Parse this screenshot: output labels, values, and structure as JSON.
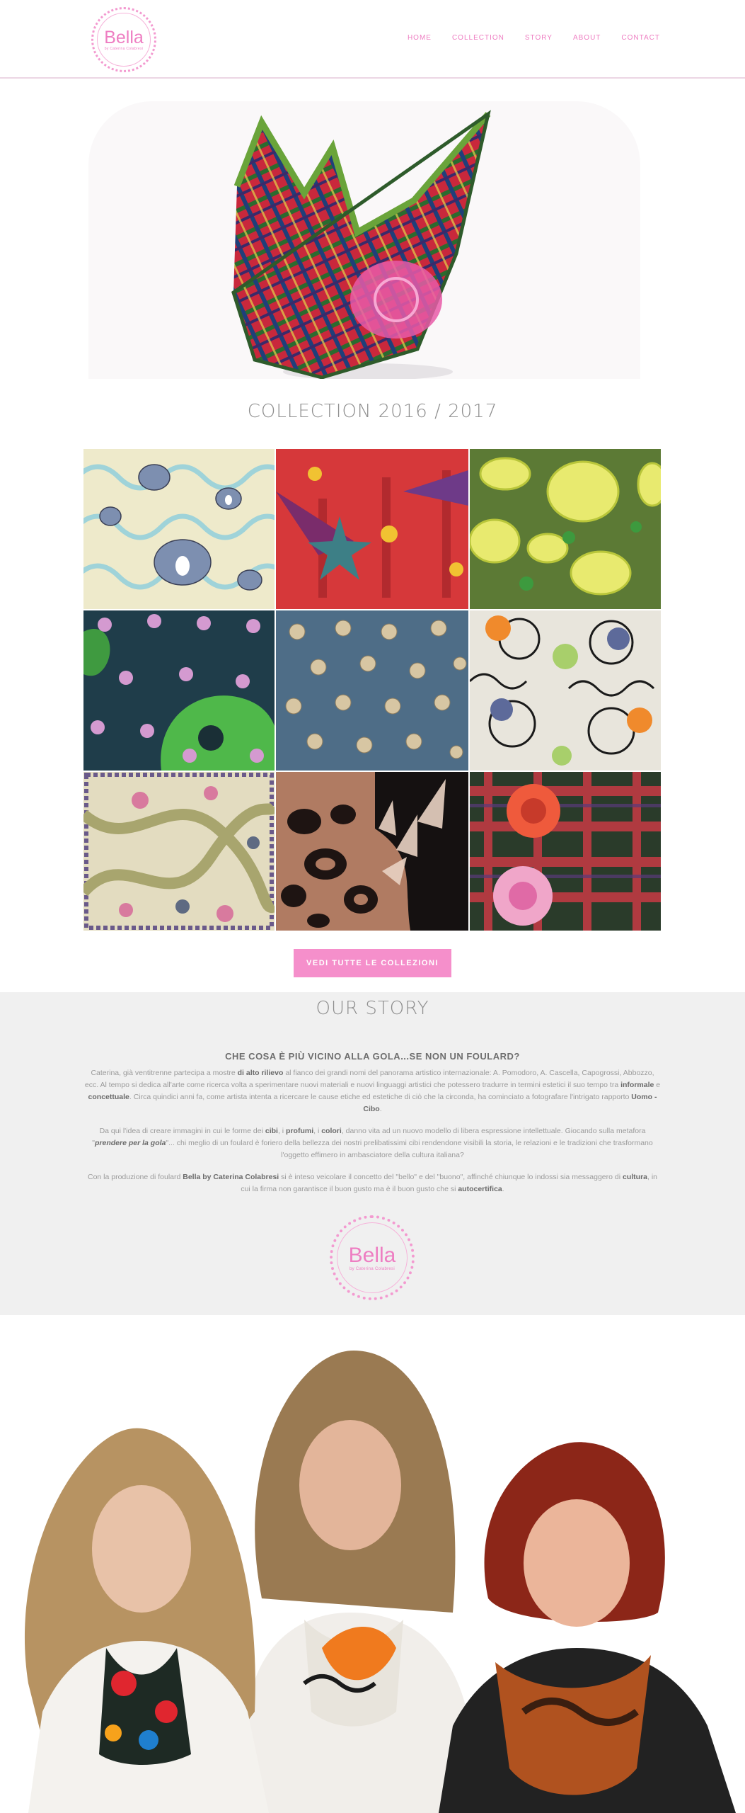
{
  "brand": {
    "logo_text": "Bella",
    "logo_tagline": "by Caterina Colabresi"
  },
  "nav": {
    "items": [
      "HOME",
      "COLLECTION",
      "STORY",
      "ABOUT",
      "CONTACT"
    ]
  },
  "collection": {
    "title": "COLLECTION 2016 / 2017",
    "tiles": [
      {
        "pattern": "pears-swirls",
        "bg": "#eeeacb",
        "accent": "#7d8fb0"
      },
      {
        "pattern": "stars-red",
        "bg": "#d6383a",
        "accent": "#3d7f86"
      },
      {
        "pattern": "lemons",
        "bg": "#5c7a35",
        "accent": "#e8ea6f"
      },
      {
        "pattern": "skulls-dark",
        "bg": "#1f3d4a",
        "accent": "#4fb84a"
      },
      {
        "pattern": "mushrooms-blue",
        "bg": "#4e6d87",
        "accent": "#d7c6a3"
      },
      {
        "pattern": "faces-flowers",
        "bg": "#e8e5dc",
        "accent": "#1a1a1a"
      },
      {
        "pattern": "ribbons-cream",
        "bg": "#e3dcc0",
        "accent": "#a8a56e"
      },
      {
        "pattern": "leopard-brown",
        "bg": "#b07b62",
        "accent": "#1e1412"
      },
      {
        "pattern": "tartan-roses",
        "bg": "#2a3b2a",
        "accent": "#e54b5c"
      }
    ],
    "button_label": "VEDI TUTTE LE COLLEZIONI"
  },
  "story": {
    "title": "OUR STORY",
    "heading": "CHE COSA È PIÙ VICINO ALLA GOLA...SE NON UN FOULARD?",
    "p1": {
      "a": "Caterina, già ventitrenne partecipa a mostre ",
      "b1": "di alto rilievo",
      "c": " al fianco dei grandi nomi del panorama artistico internazionale: A. Pomodoro, A. Cascella, Capogrossi, Abbozzo, ecc. Al tempo si dedica all'arte come ricerca volta a sperimentare nuovi materiali e nuovi linguaggi artistici che potessero tradurre in termini estetici il suo tempo tra ",
      "b2": "informale",
      "d": " e ",
      "b3": "concettuale",
      "e": ". Circa quindici anni fa, come artista intenta a ricercare le cause etiche ed estetiche di ciò che la circonda, ha cominciato a fotografare l'intrigato rapporto ",
      "b4": "Uomo - Cibo",
      "f": "."
    },
    "p2": {
      "a": "Da qui l'idea di creare immagini in cui le forme dei ",
      "b1": "cibi",
      "c": ", i ",
      "b2": "profumi",
      "d": ", i ",
      "b3": "colori",
      "e": ", danno vita ad un nuovo modello di libera espressione intellettuale. Giocando sulla metafora \"",
      "i1": "prendere per la gola",
      "f": "\"... chi meglio di un foulard è foriero della bellezza dei nostri prelibatissimi cibi rendendone visibili la storia, le relazioni e le tradizioni che trasformano l'oggetto effimero in ambasciatore della cultura italiana?"
    },
    "p3": {
      "a": "Con la produzione di foulard ",
      "b1": "Bella by Caterina Colabresi",
      "c": " si è inteso veicolare il concetto del \"bello\" e del \"buono\", affinché chiunque lo indossi sia messaggero di ",
      "b2": "cultura",
      "d": ", in cui la firma non garantisce il buon gusto ma è il buon gusto che si ",
      "b3": "autocertifica",
      "e": "."
    }
  },
  "colors": {
    "accent_pink": "#f58fcb",
    "logo_pink": "#ee7ec2",
    "story_bg": "#f0f0f0"
  }
}
